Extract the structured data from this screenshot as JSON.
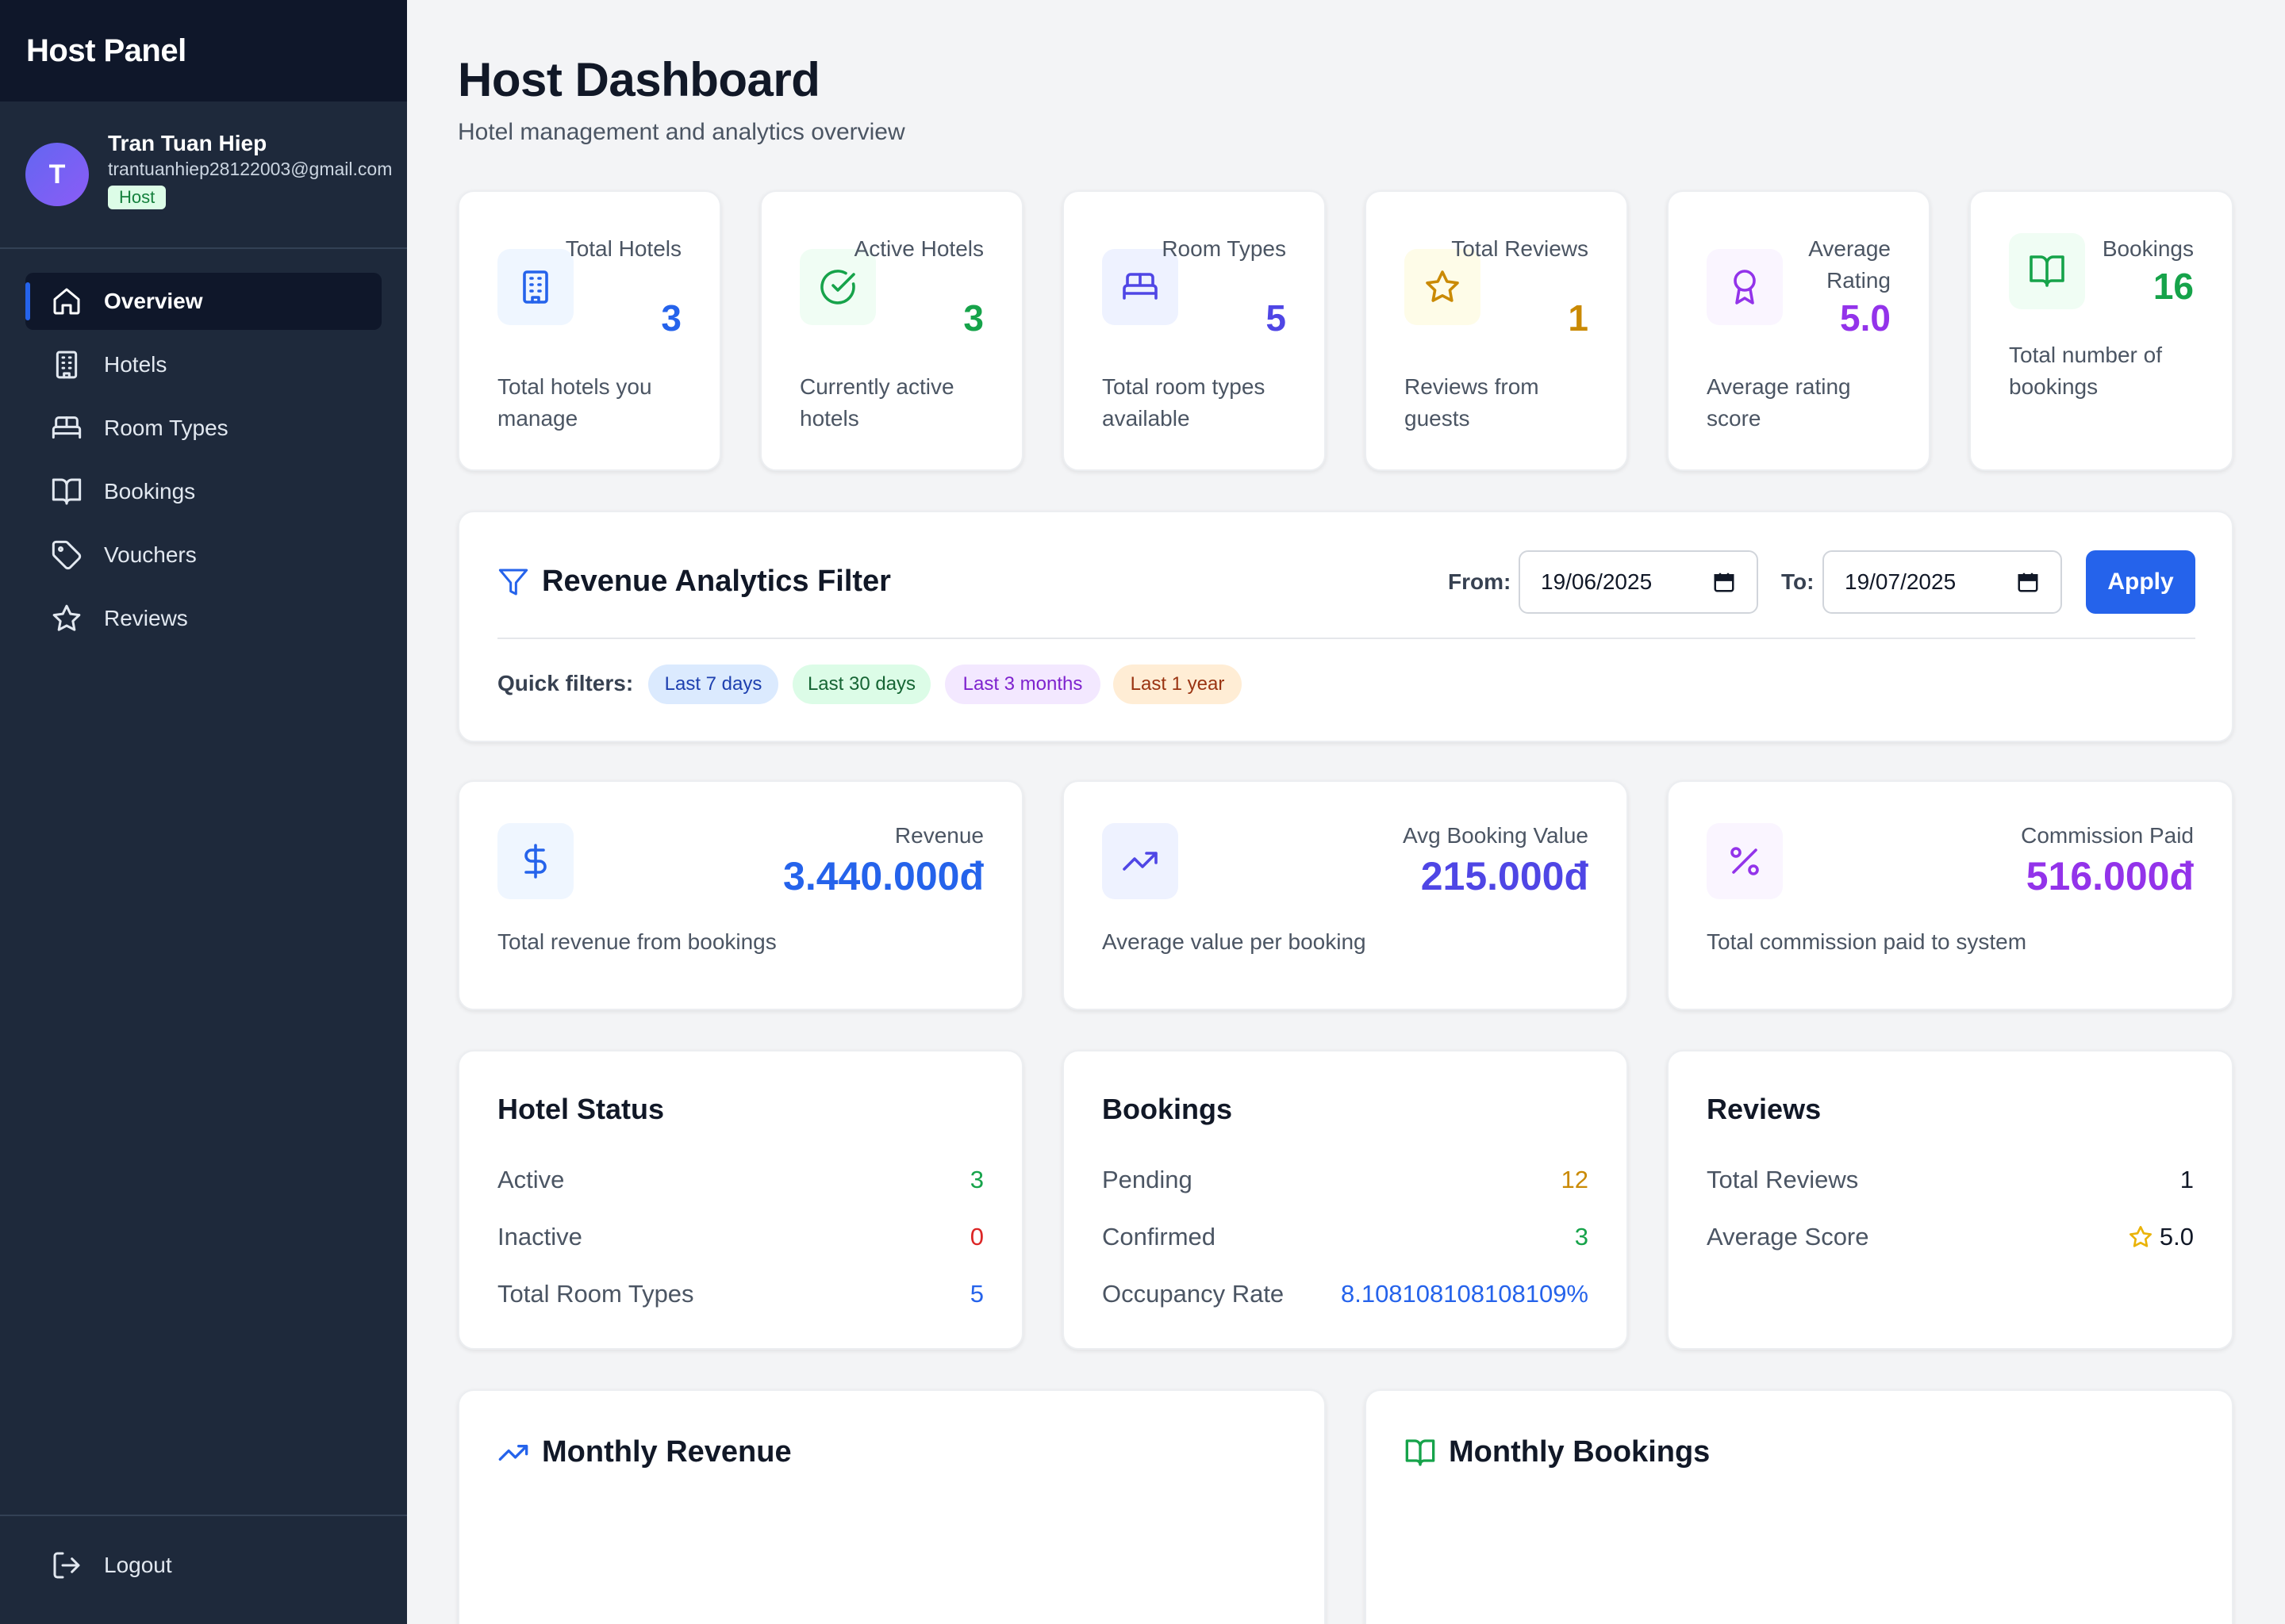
{
  "sidebar": {
    "title": "Host Panel",
    "user": {
      "initial": "T",
      "name": "Tran Tuan Hiep",
      "email": "trantuanhiep28122003@gmail.com",
      "role": "Host"
    },
    "nav": [
      {
        "label": "Overview",
        "icon": "home-icon",
        "active": true
      },
      {
        "label": "Hotels",
        "icon": "building-icon"
      },
      {
        "label": "Room Types",
        "icon": "bed-icon"
      },
      {
        "label": "Bookings",
        "icon": "book-icon"
      },
      {
        "label": "Vouchers",
        "icon": "tag-icon"
      },
      {
        "label": "Reviews",
        "icon": "star-icon"
      }
    ],
    "logout": "Logout"
  },
  "header": {
    "title": "Host Dashboard",
    "subtitle": "Hotel management and analytics overview"
  },
  "stats": [
    {
      "label": "Total Hotels",
      "value": "3",
      "desc": "Total hotels you manage",
      "icon": "building-icon",
      "color": "#2563eb",
      "bg": "#eff6ff"
    },
    {
      "label": "Active Hotels",
      "value": "3",
      "desc": "Currently active hotels",
      "icon": "check-circle-icon",
      "color": "#16a34a",
      "bg": "#f0fdf4"
    },
    {
      "label": "Room Types",
      "value": "5",
      "desc": "Total room types available",
      "icon": "bed-icon",
      "color": "#4f46e5",
      "bg": "#eef2ff"
    },
    {
      "label": "Total Reviews",
      "value": "1",
      "desc": "Reviews from guests",
      "icon": "star-icon",
      "color": "#ca8a04",
      "bg": "#fefce8"
    },
    {
      "label": "Average Rating",
      "value": "5.0",
      "desc": "Average rating score",
      "icon": "award-icon",
      "color": "#9333ea",
      "bg": "#faf5ff"
    },
    {
      "label": "Bookings",
      "value": "16",
      "desc": "Total number of bookings",
      "icon": "book-icon",
      "color": "#16a34a",
      "bg": "#f0fdf4"
    }
  ],
  "filter": {
    "title": "Revenue Analytics Filter",
    "from_label": "From:",
    "from_value": "19/06/2025",
    "to_label": "To:",
    "to_value": "19/07/2025",
    "apply": "Apply",
    "quick_label": "Quick filters:",
    "quick": [
      {
        "label": "Last 7 days",
        "color": "#1e40af",
        "bg": "#dbeafe"
      },
      {
        "label": "Last 30 days",
        "color": "#166534",
        "bg": "#dcfce7"
      },
      {
        "label": "Last 3 months",
        "color": "#7e22ce",
        "bg": "#f3e8ff"
      },
      {
        "label": "Last 1 year",
        "color": "#9a3412",
        "bg": "#ffedd5"
      }
    ]
  },
  "revenue": [
    {
      "label": "Revenue",
      "value": "3.440.000đ",
      "desc": "Total revenue from bookings",
      "icon": "dollar-icon",
      "color": "#2563eb",
      "bg": "#eff6ff"
    },
    {
      "label": "Avg Booking Value",
      "value": "215.000đ",
      "desc": "Average value per booking",
      "icon": "trending-up-icon",
      "color": "#4f46e5",
      "bg": "#eef2ff"
    },
    {
      "label": "Commission Paid",
      "value": "516.000đ",
      "desc": "Total commission paid to system",
      "icon": "percent-icon",
      "color": "#9333ea",
      "bg": "#faf5ff"
    }
  ],
  "summary": [
    {
      "title": "Hotel Status",
      "rows": [
        {
          "key": "Active",
          "value": "3",
          "color": "#16a34a"
        },
        {
          "key": "Inactive",
          "value": "0",
          "color": "#dc2626"
        },
        {
          "key": "Total Room Types",
          "value": "5",
          "color": "#2563eb"
        }
      ]
    },
    {
      "title": "Bookings",
      "rows": [
        {
          "key": "Pending",
          "value": "12",
          "color": "#ca8a04"
        },
        {
          "key": "Confirmed",
          "value": "3",
          "color": "#16a34a"
        },
        {
          "key": "Occupancy Rate",
          "value": "8.108108108108109%",
          "color": "#2563eb"
        }
      ]
    },
    {
      "title": "Reviews",
      "rows": [
        {
          "key": "Total Reviews",
          "value": "1",
          "color": "#111827"
        },
        {
          "key": "Average Score",
          "value": "5.0",
          "color": "#111827"
        }
      ]
    }
  ],
  "charts": [
    {
      "title": "Monthly Revenue",
      "icon": "trending-up-icon",
      "color": "#2563eb"
    },
    {
      "title": "Monthly Bookings",
      "icon": "book-icon",
      "color": "#16a34a"
    }
  ]
}
